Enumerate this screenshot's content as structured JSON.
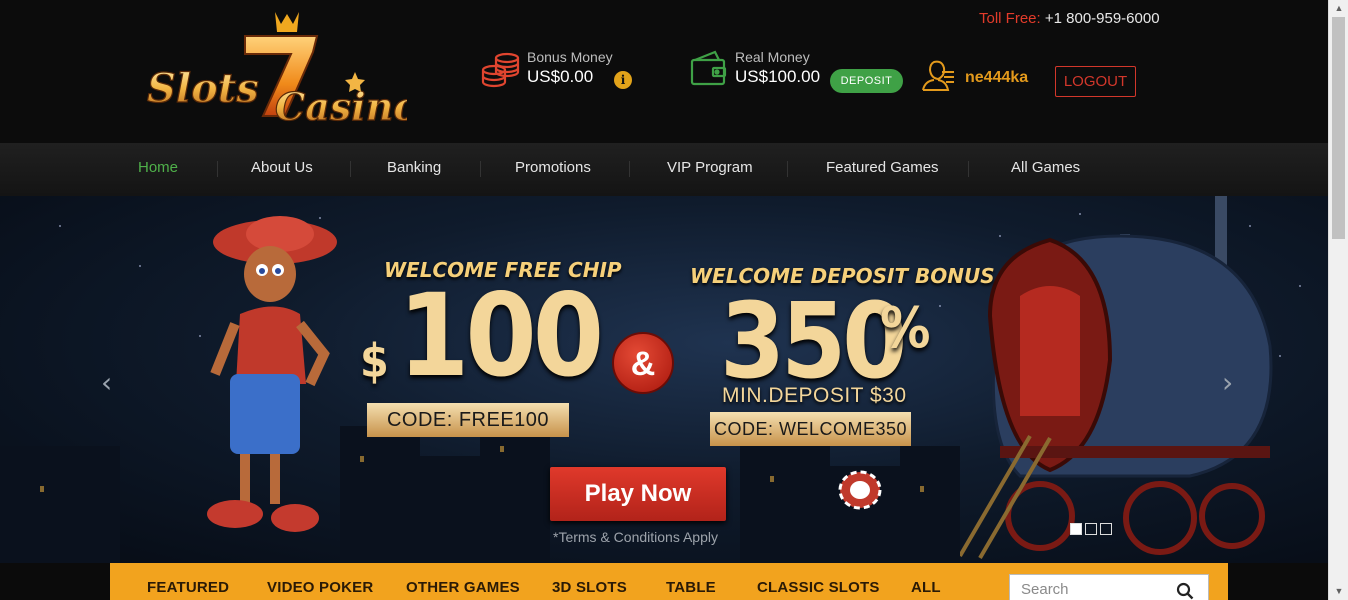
{
  "brand": {
    "logo_text_left": "Slots",
    "logo_seven": "7",
    "logo_text_right": "Casino"
  },
  "header": {
    "toll_free_label": "Toll Free:",
    "toll_free_number": "+1 800-959-6000",
    "bonus_caption": "Bonus Money",
    "bonus_amount": "US$0.00",
    "info_icon": "i",
    "real_caption": "Real Money",
    "real_amount": "US$100.00",
    "deposit_label": "DEPOSIT",
    "username": "ne444ka",
    "logout_label": "LOGOUT"
  },
  "nav": {
    "items": [
      {
        "label": "Home",
        "active": true
      },
      {
        "label": "About Us"
      },
      {
        "label": "Banking"
      },
      {
        "label": "Promotions"
      },
      {
        "label": "VIP Program"
      },
      {
        "label": "Featured Games"
      },
      {
        "label": "All Games"
      }
    ]
  },
  "hero": {
    "chip_title": "WELCOME FREE CHIP",
    "chip_currency": "$",
    "chip_amount": "100",
    "chip_code": "CODE:  FREE100",
    "ampersand": "&",
    "bonus_title": "WELCOME DEPOSIT BONUS",
    "bonus_amount": "350",
    "bonus_percent": "%",
    "min_deposit": "MIN.DEPOSIT $30",
    "bonus_code": "CODE:  WELCOME350",
    "play_label": "Play Now",
    "terms": "*Terms & Conditions Apply",
    "prev_arrow": "‹",
    "next_arrow": "›",
    "slide_count": 3,
    "active_slide": 1
  },
  "game_tabs": {
    "items": [
      "FEATURED",
      "VIDEO POKER",
      "OTHER GAMES",
      "3D SLOTS",
      "TABLE",
      "CLASSIC SLOTS",
      "ALL"
    ],
    "search_placeholder": "Search"
  },
  "colors": {
    "accent_green": "#4fb04a",
    "accent_red": "#d2372b",
    "accent_orange": "#f2a31e",
    "username_gold": "#e39a1c"
  },
  "icons": {
    "bonus": "coin-stack-icon",
    "real": "wallet-icon",
    "user": "user-icon",
    "search": "search-icon"
  }
}
